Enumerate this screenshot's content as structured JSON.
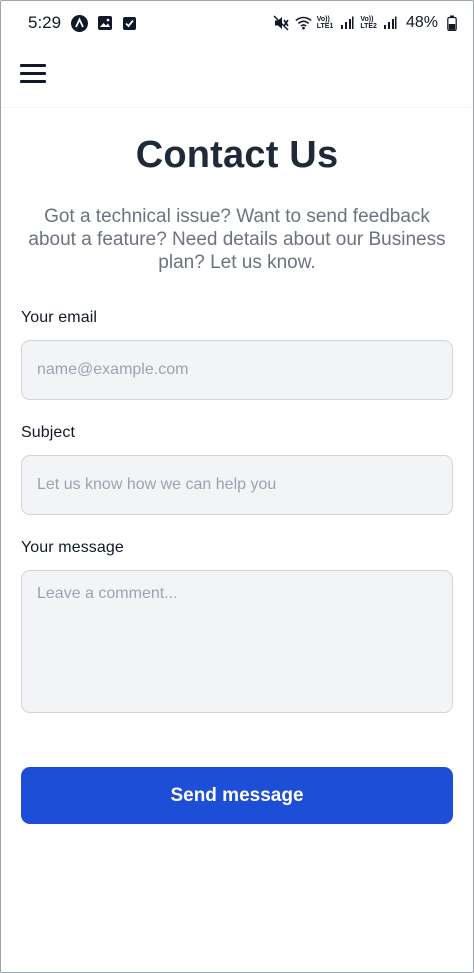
{
  "status_bar": {
    "time": "5:29",
    "battery_percent": "48%",
    "signal_1_label_top": "Vo))",
    "signal_1_label_bottom": "LTE1",
    "signal_2_label_top": "Vo))",
    "signal_2_label_bottom": "LTE2",
    "icons": [
      "app-notification-icon",
      "image-icon",
      "checkbox-icon",
      "mute-icon",
      "wifi-icon",
      "signal-icon",
      "signal-icon",
      "battery-icon"
    ]
  },
  "header": {
    "menu_icon": "hamburger-menu-icon"
  },
  "main": {
    "title": "Contact Us",
    "subtitle": "Got a technical issue? Want to send feedback about a feature? Need details about our Business plan? Let us know."
  },
  "form": {
    "email_label": "Your email",
    "email_placeholder": "name@example.com",
    "email_value": "",
    "subject_label": "Subject",
    "subject_placeholder": "Let us know how we can help you",
    "subject_value": "",
    "message_label": "Your message",
    "message_placeholder": "Leave a comment...",
    "message_value": "",
    "submit_label": "Send message"
  },
  "colors": {
    "accent": "#1d4ed8",
    "input_bg": "#f3f4f6",
    "input_border": "#d1d5db",
    "title": "#1f2937",
    "subtitle": "#6b7280"
  }
}
